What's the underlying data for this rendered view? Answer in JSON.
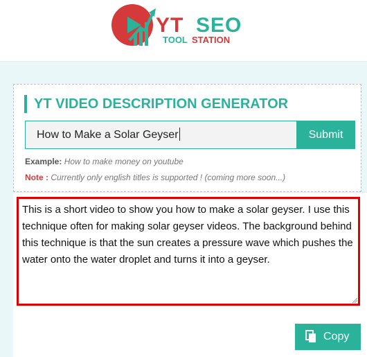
{
  "logo": {
    "text_yt": "YT",
    "text_seo": "SEO",
    "text_tool": "TOOL",
    "text_station": "STATION",
    "colors": {
      "red": "#d43a3a",
      "teal": "#2bb29a"
    }
  },
  "tool": {
    "title": "YT VIDEO DESCRIPTION GENERATOR",
    "input_value": "How to Make a Solar Geyser",
    "submit_label": "Submit",
    "example_label": "Example:",
    "example_text": "How to make money on youtube",
    "note_label": "Note :",
    "note_text": "Currently only english titles is supported ! (coming more soon...)"
  },
  "result": {
    "description": "This is a short video to show you how to make a solar geyser. I use this technique often for making solar geyser videos. The background behind this technique is that the sun creates a pressure wave which pushes the water onto the water droplet and turns it into a geyser.",
    "copy_label": "Copy",
    "copy_icon": "copy-icon"
  },
  "colors": {
    "accent": "#2bb29a",
    "highlight_border": "#e00000",
    "background": "#eaf7f9"
  }
}
